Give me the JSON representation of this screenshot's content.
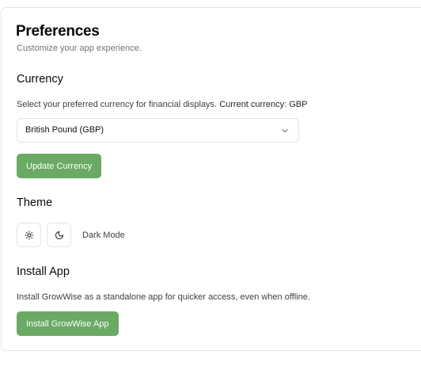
{
  "header": {
    "title": "Preferences",
    "subtitle": "Customize your app experience."
  },
  "currency": {
    "title": "Currency",
    "description": "Select your preferred currency for financial displays.",
    "current_label": "Current currency: GBP",
    "selected_option": "British Pound (GBP)",
    "button_label": "Update Currency"
  },
  "theme": {
    "title": "Theme",
    "light_icon": "sun-icon",
    "dark_icon": "moon-icon",
    "current_label": "Dark Mode"
  },
  "install": {
    "title": "Install App",
    "description": "Install GrowWise as a standalone app for quicker access, even when offline.",
    "button_label": "Install GrowWise App"
  },
  "colors": {
    "accent": "#6aaa64",
    "border": "#e4e4e7",
    "muted_text": "#71717a"
  }
}
